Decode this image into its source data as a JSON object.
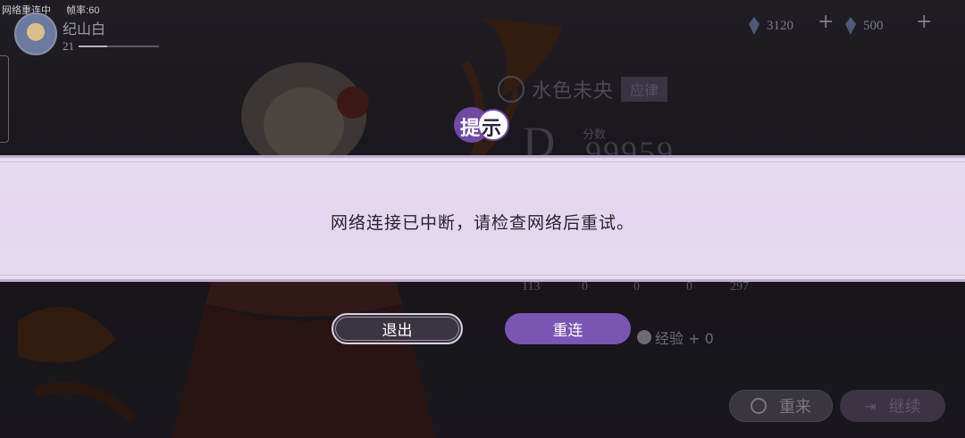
{
  "debug": {
    "network_status": "网络重连中",
    "fps_label": "帧率:60"
  },
  "player": {
    "name": "纪山白",
    "level": "21",
    "level_progress": 0.35
  },
  "currencies": [
    {
      "icon": "crystal-icon",
      "value": "3120"
    },
    {
      "icon": "crystal-icon",
      "value": "500"
    }
  ],
  "song": {
    "title": "水色未央",
    "tag": "应律"
  },
  "result": {
    "rank": "D",
    "score_label": "分数",
    "score": "99959",
    "stats": [
      "113",
      "0",
      "0",
      "0",
      "297"
    ],
    "exp": "经验 + 0"
  },
  "bottom_buttons": {
    "retry": "重来",
    "continue": "继续"
  },
  "dialog": {
    "title": "提示",
    "message": "网络连接已中断，请检查网络后重试。",
    "exit_label": "退出",
    "reconnect_label": "重连"
  },
  "colors": {
    "accent": "#7a55b3",
    "dialog_bg": "#e6daee"
  }
}
